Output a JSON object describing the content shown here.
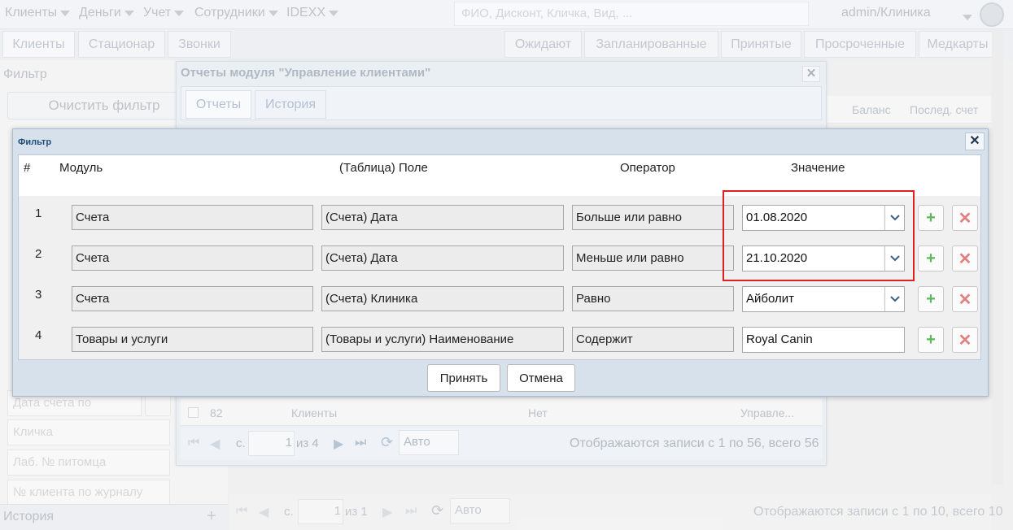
{
  "topbar": {
    "menus": [
      "Клиенты",
      "Деньги",
      "Учет",
      "Сотрудники",
      "IDEXX"
    ],
    "search_placeholder": "ФИО, Дисконт, Кличка, Вид, ...",
    "user": "admin/Клиника"
  },
  "left_tabs": [
    "Клиенты",
    "Стационар",
    "Звонки"
  ],
  "right_tabs": [
    "Ожидают",
    "Запланированные",
    "Принятые",
    "Просроченные",
    "Медкарты"
  ],
  "left_panel": {
    "title": "Фильтр",
    "clear_button": "Очистить фильтр",
    "fields": [
      "Дата счета по",
      "Кличка",
      "Лаб. № питомца",
      "№ клиента по журналу"
    ],
    "history": "История"
  },
  "main_grid": {
    "columns": [
      "Баланс",
      "Послед. счет"
    ],
    "pager": {
      "page_label": "с.",
      "page": "1",
      "of": "из 1",
      "size": "Авто",
      "status": "Отображаются записи с 1 по 10, всего 10"
    }
  },
  "reports_dialog": {
    "title": "Отчеты модуля \"Управление клиентами\"",
    "tabs": [
      "Отчеты",
      "История"
    ],
    "row": {
      "id": "82",
      "module": "Клиенты",
      "flag": "Нет",
      "type": "Управле..."
    },
    "pager": {
      "page_label": "с.",
      "page": "1",
      "of": "из 4",
      "size": "Авто",
      "status": "Отображаются записи с 1 по 56, всего 56"
    }
  },
  "filter_dialog": {
    "title": "Фильтр",
    "headers": {
      "num": "#",
      "module": "Модуль",
      "field": "(Таблица) Поле",
      "operator": "Оператор",
      "value": "Значение"
    },
    "rows": [
      {
        "num": "1",
        "module": "Счета",
        "field": "(Счета) Дата",
        "operator": "Больше или равно",
        "value": "01.08.2020",
        "dropdown": true
      },
      {
        "num": "2",
        "module": "Счета",
        "field": "(Счета) Дата",
        "operator": "Меньше или равно",
        "value": "21.10.2020",
        "dropdown": true
      },
      {
        "num": "3",
        "module": "Счета",
        "field": "(Счета) Клиника",
        "operator": "Равно",
        "value": "Айболит",
        "dropdown": true
      },
      {
        "num": "4",
        "module": "Товары и услуги",
        "field": "(Товары и услуги) Наименование",
        "operator": "Содержит",
        "value": "Royal Canin",
        "dropdown": false
      }
    ],
    "accept_button": "Принять",
    "cancel_button": "Отмена",
    "highlight_color": "#e02020"
  }
}
